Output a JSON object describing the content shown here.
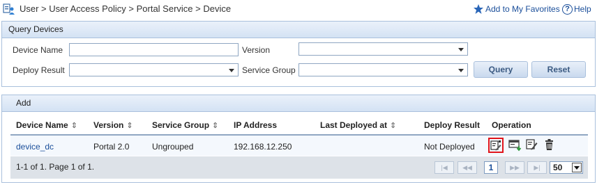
{
  "breadcrumb": "User > User Access Policy > Portal Service > Device",
  "favorites_label": "Add to My Favorites",
  "help_label": "Help",
  "query": {
    "title": "Query Devices",
    "device_name_label": "Device Name",
    "device_name_value": "",
    "version_label": "Version",
    "version_value": "",
    "deploy_result_label": "Deploy Result",
    "deploy_result_value": "",
    "service_group_label": "Service Group",
    "service_group_value": "",
    "query_button": "Query",
    "reset_button": "Reset"
  },
  "list": {
    "add_label": "Add",
    "columns": [
      "Device Name",
      "Version",
      "Service Group",
      "IP Address",
      "Last Deployed at",
      "Deploy Result",
      "Operation"
    ],
    "rows": [
      {
        "device_name": "device_dc",
        "version": "Portal 2.0",
        "service_group": "Ungrouped",
        "ip_address": "192.168.12.250",
        "last_deployed_at": "",
        "deploy_result": "Not Deployed"
      }
    ],
    "operations": [
      "deploy-icon",
      "export-icon",
      "edit-icon",
      "delete-icon"
    ],
    "highlighted_operation": "deploy-icon"
  },
  "pagination": {
    "summary": "1-1 of 1. Page 1 of 1.",
    "current_page": "1",
    "page_size": "50"
  },
  "colors": {
    "link": "#1a4e9a",
    "panel_border": "#a9c0dc",
    "highlight": "#e0141b"
  }
}
